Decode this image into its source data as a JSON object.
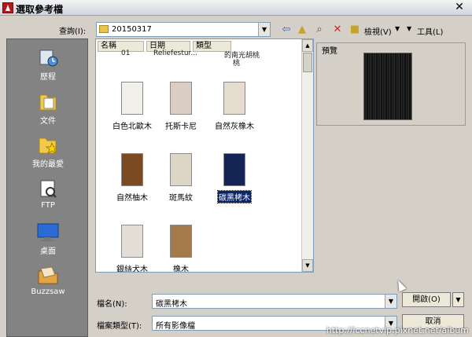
{
  "window": {
    "title": "選取參考檔",
    "close_glyph": "✕"
  },
  "lookin": {
    "label": "查詢(I):",
    "value": "20150317"
  },
  "toolbar": {
    "views_label": "檢視(V)",
    "tools_label": "工具(L)"
  },
  "places": [
    {
      "label": "歷程",
      "icon": "history-icon"
    },
    {
      "label": "文件",
      "icon": "documents-icon"
    },
    {
      "label": "我的最愛",
      "icon": "favorites-icon"
    },
    {
      "label": "FTP",
      "icon": "ftp-icon"
    },
    {
      "label": "桌面",
      "icon": "desktop-icon"
    },
    {
      "label": "Buzzsaw",
      "icon": "buzzsaw-icon"
    }
  ],
  "columns": [
    "名稱",
    "日期",
    "類型"
  ],
  "overflow_row": [
    "01",
    "Reliefestur...",
    "的南光胡桃"
  ],
  "overflow_extra": "桃",
  "tiles": [
    {
      "name": "白色北歐木",
      "color": "#f2f0ea"
    },
    {
      "name": "托斯卡尼",
      "color": "#d9cdc4"
    },
    {
      "name": "自然灰橡木",
      "color": "#e6ddd0"
    },
    {
      "name": "自然柚木",
      "color": "#7b4a22"
    },
    {
      "name": "斑馬紋",
      "color": "#ddd5c6"
    },
    {
      "name": "碳黑栲木",
      "color": "#132455"
    },
    {
      "name": "銀絲犬木",
      "color": "#e3ded6"
    },
    {
      "name": "橡木",
      "color": "#a57a4a"
    }
  ],
  "selected_tile": "碳黑栲木",
  "preview": {
    "label": "預覽"
  },
  "filename": {
    "label": "檔名(N):",
    "value": "碳黑栲木"
  },
  "filetype": {
    "label": "檔案類型(T):",
    "value": "所有影像檔"
  },
  "buttons": {
    "open": "開啟(O)",
    "cancel": "取消"
  },
  "watermark": "http://lccnetvip.pixnet.net/album"
}
